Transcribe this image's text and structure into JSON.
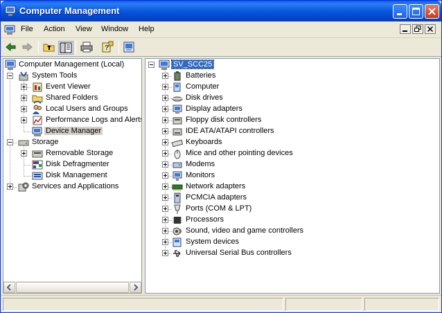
{
  "window": {
    "title": "Computer Management",
    "icon": "computer-management-icon",
    "controls": [
      "minimize-icon",
      "maximize-icon",
      "close-icon"
    ]
  },
  "menu": {
    "items": [
      "File",
      "Action",
      "View",
      "Window",
      "Help"
    ]
  },
  "toolbar": {
    "buttons": [
      "back-arrow-icon",
      "forward-arrow-icon",
      "up-folder-icon",
      "show-hide-tree-icon",
      "print-icon",
      "help-icon",
      "properties-icon"
    ]
  },
  "tree": {
    "root": "Computer Management (Local)",
    "system_tools": {
      "label": "System Tools",
      "children": [
        "Event Viewer",
        "Shared Folders",
        "Local Users and Groups",
        "Performance Logs and Alerts",
        "Device Manager"
      ]
    },
    "storage": {
      "label": "Storage",
      "children": [
        "Removable Storage",
        "Disk Defragmenter",
        "Disk Management"
      ]
    },
    "services": "Services and Applications"
  },
  "devices": {
    "computer_name": "SV_SCC25",
    "categories": [
      "Batteries",
      "Computer",
      "Disk drives",
      "Display adapters",
      "Floppy disk controllers",
      "IDE ATA/ATAPI controllers",
      "Keyboards",
      "Mice and other pointing devices",
      "Modems",
      "Monitors",
      "Network adapters",
      "PCMCIA adapters",
      "Ports (COM & LPT)",
      "Processors",
      "Sound, video and game controllers",
      "System devices",
      "Universal Serial Bus controllers"
    ]
  },
  "colors": {
    "titlebar": "#0858de",
    "selection": "#316ac5",
    "chrome": "#ece9d8"
  }
}
